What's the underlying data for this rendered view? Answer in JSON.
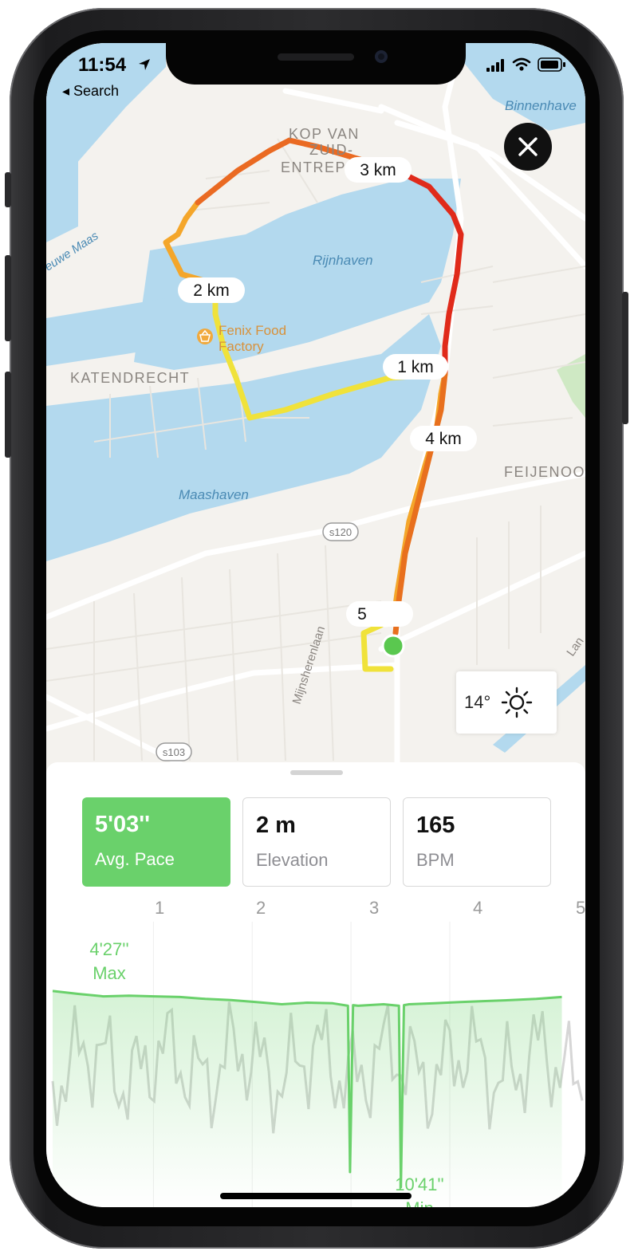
{
  "status_bar": {
    "time": "11:54",
    "back_label": "◂ Search"
  },
  "map": {
    "water_labels": [
      "Binnenhave",
      "Rijnhaven",
      "Maashaven",
      "euwe Maas"
    ],
    "district_labels": [
      "KOP VAN",
      "ZUID-",
      "ENTREP",
      "KATENDRECHT",
      "FEIJENOO"
    ],
    "street_labels": [
      "Mijnsherenlaan",
      "Lan"
    ],
    "road_badges": [
      "s120",
      "s103"
    ],
    "poi": {
      "name_line1": "Fenix Food",
      "name_line2": "Factory",
      "icon": "basket-icon"
    },
    "km_markers": [
      "1 km",
      "2 km",
      "3 km",
      "4 km",
      "5"
    ],
    "start_color": "#5ac84f",
    "end_color": "#e0241b",
    "route_colors": [
      "#f0e23a",
      "#f4a62a",
      "#ea6a22",
      "#e02a1a"
    ]
  },
  "weather": {
    "temperature": "14°",
    "icon": "sun-icon"
  },
  "stats": [
    {
      "value": "5'03''",
      "label": "Avg. Pace",
      "active": true
    },
    {
      "value": "2 m",
      "label": "Elevation",
      "active": false
    },
    {
      "value": "165",
      "label": "BPM",
      "active": false
    }
  ],
  "chart_data": {
    "type": "line",
    "x_ticks": [
      "1",
      "2",
      "3",
      "4",
      "5"
    ],
    "series": [
      {
        "x": [
          0,
          0.25,
          0.5,
          0.75,
          1.0,
          1.25,
          1.5,
          1.75,
          2.0,
          2.25,
          2.5,
          2.75,
          2.9,
          2.92,
          2.95,
          3.0,
          3.25,
          3.4,
          3.42,
          3.45,
          3.5,
          3.75,
          4.0,
          4.25,
          4.5,
          4.75,
          5.0
        ],
        "y": [
          4.43,
          4.52,
          4.6,
          4.58,
          4.6,
          4.62,
          4.68,
          4.72,
          4.78,
          4.85,
          4.8,
          4.82,
          4.9,
          10.2,
          4.88,
          4.9,
          4.85,
          4.9,
          10.68,
          4.88,
          4.85,
          4.82,
          4.78,
          4.75,
          4.72,
          4.68,
          4.62
        ]
      }
    ],
    "max_label": "4'27''",
    "max_caption": "Max",
    "min_label": "10'41''",
    "min_caption": "Min",
    "line_color": "#6ad16b",
    "background_series_color": "#d6d6d6"
  }
}
